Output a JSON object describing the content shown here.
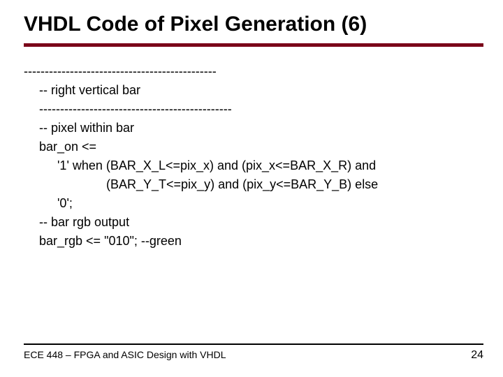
{
  "title": "VHDL Code of Pixel Generation (6)",
  "code": {
    "l1": "----------------------------------------------",
    "l2": "-- right vertical bar",
    "l3": "----------------------------------------------",
    "l4": "-- pixel within bar",
    "l5": "bar_on <=",
    "l6": "'1' when (BAR_X_L<=pix_x) and (pix_x<=BAR_X_R) and",
    "l7": "(BAR_Y_T<=pix_y) and (pix_y<=BAR_Y_B) else",
    "l8": "'0';",
    "l9": "-- bar rgb output",
    "l10": "bar_rgb <= \"010\"; --green"
  },
  "footer": {
    "left": "ECE 448 – FPGA and ASIC Design with VHDL",
    "page": "24"
  }
}
